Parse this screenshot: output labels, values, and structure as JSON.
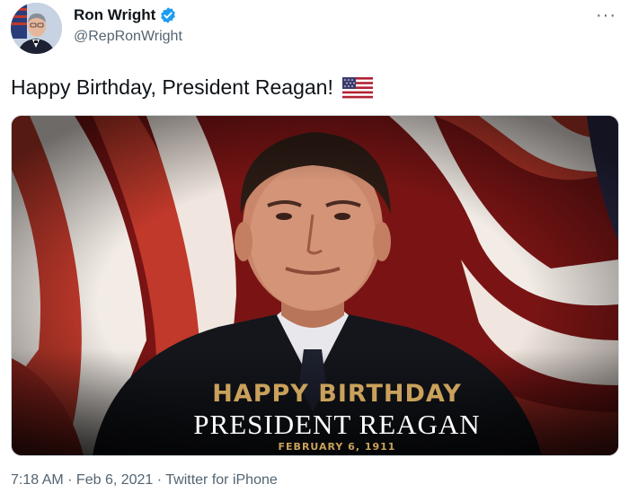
{
  "author": {
    "display_name": "Ron Wright",
    "handle": "@RepRonWright",
    "verified": true
  },
  "tweet": {
    "text": "Happy Birthday, President Reagan!",
    "emoji": "us-flag"
  },
  "media": {
    "line1": "HAPPY BIRTHDAY",
    "line2": "PRESIDENT REAGAN",
    "line3": "FEBRUARY 6, 1911"
  },
  "meta": {
    "time": "7:18 AM",
    "separator1": " · ",
    "date": "Feb 6, 2021",
    "separator2": " · ",
    "source": "Twitter for iPhone"
  },
  "colors": {
    "verified_blue": "#1d9bf0",
    "secondary_text": "#536471",
    "gold": "#c9a15b",
    "flag_red": "#b22234"
  }
}
